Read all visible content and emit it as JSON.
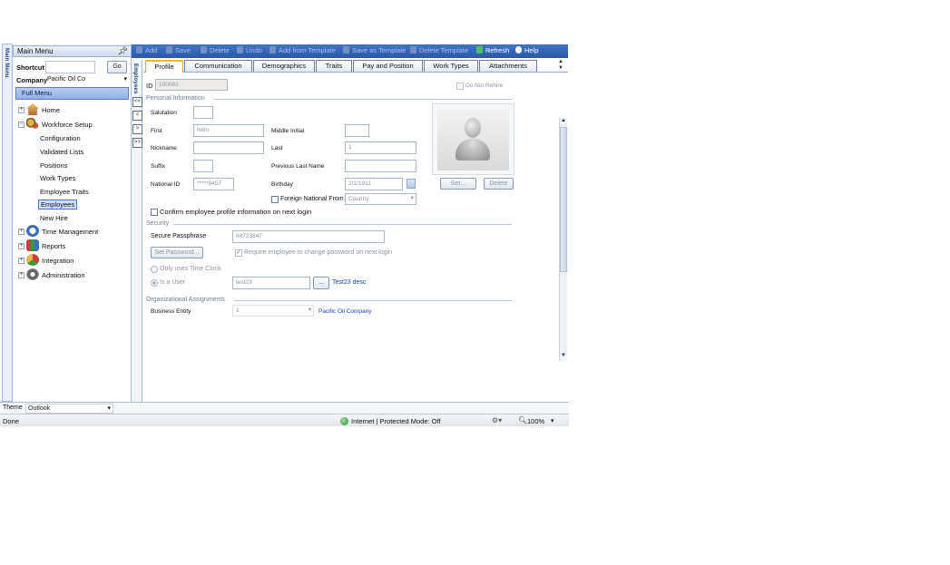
{
  "rail": {
    "label": "Main Menu"
  },
  "menu": {
    "title": "Main Menu",
    "pin_icon": "pin-icon",
    "shortcut_label": "Shortcut",
    "shortcut_value": "",
    "go_label": "Go",
    "company_label": "Company",
    "company_value": "Pacific Oil Co",
    "full_menu_label": "Full Menu",
    "tree": {
      "home": "Home",
      "workforce_setup": "Workforce Setup",
      "configuration": "Configuration",
      "validated_lists": "Validated Lists",
      "positions": "Positions",
      "work_types": "Work Types",
      "employee_traits": "Employee Traits",
      "employees": "Employees",
      "new_hire": "New Hire",
      "time_management": "Time Management",
      "reports": "Reports",
      "integration": "Integration",
      "administration": "Administration"
    }
  },
  "strip": {
    "label": "Employees",
    "arrows": [
      "<<",
      "<",
      ">",
      ">>"
    ]
  },
  "toolbar": {
    "add": "Add",
    "save": "Save",
    "delete": "Delete",
    "undo": "Undo",
    "add_from_template": "Add from Template",
    "save_as_template": "Save as Template",
    "delete_template": "Delete Template",
    "refresh": "Refresh",
    "help": "Help"
  },
  "tabs": [
    "Profile",
    "Communication",
    "Demographics",
    "Traits",
    "Pay and Position",
    "Work Types",
    "Attachments"
  ],
  "form": {
    "id_label": "ID",
    "id_value": "100082",
    "do_not_rehire": "Do Not Rehire",
    "personal_info_section": "Personal Information",
    "salutation_label": "Salutation",
    "salutation_value": "",
    "first_label": "First",
    "first_value": "Nitin",
    "middle_initial_label": "Middle Initial",
    "middle_initial_value": "",
    "nickname_label": "Nickname",
    "nickname_value": "",
    "last_label": "Last",
    "last_value": "1",
    "suffix_label": "Suffix",
    "suffix_value": "",
    "previous_last_name_label": "Previous Last Name",
    "previous_last_name_value": "",
    "national_id_label": "National ID",
    "national_id_value": "*****8457",
    "birthday_label": "Birthday",
    "birthday_value": "2/1/1911",
    "foreign_national_label": "Foreign National From",
    "country_placeholder": "Country",
    "photo_set": "Set...",
    "photo_delete": "Delete",
    "confirm_profile": "Confirm employee profile information on next login",
    "security_section": "Security",
    "passphrase_label": "Secure Passphrase",
    "passphrase_value": "84723847",
    "set_password": "Set Password...",
    "require_change": "Require employee to change password on next login",
    "only_time_clock": "Only uses Time Clock",
    "is_a_user": "Is a User",
    "user_value": "test23",
    "user_browse": "...",
    "user_desc": "Test23 desc",
    "org_section": "Organizational Assignments",
    "business_entity_label": "Business Entity",
    "business_entity_value": "1",
    "business_entity_desc": "Pacific Oil Company"
  },
  "theme": {
    "label": "Theme",
    "value": "Outlook"
  },
  "status": {
    "done": "Done",
    "zone": "Internet | Protected Mode: Off",
    "zoom": "100%"
  },
  "colors": {
    "toolbar": "#2f5fb3",
    "active_tab": "#f0b43c",
    "link": "#1a3cc8"
  }
}
